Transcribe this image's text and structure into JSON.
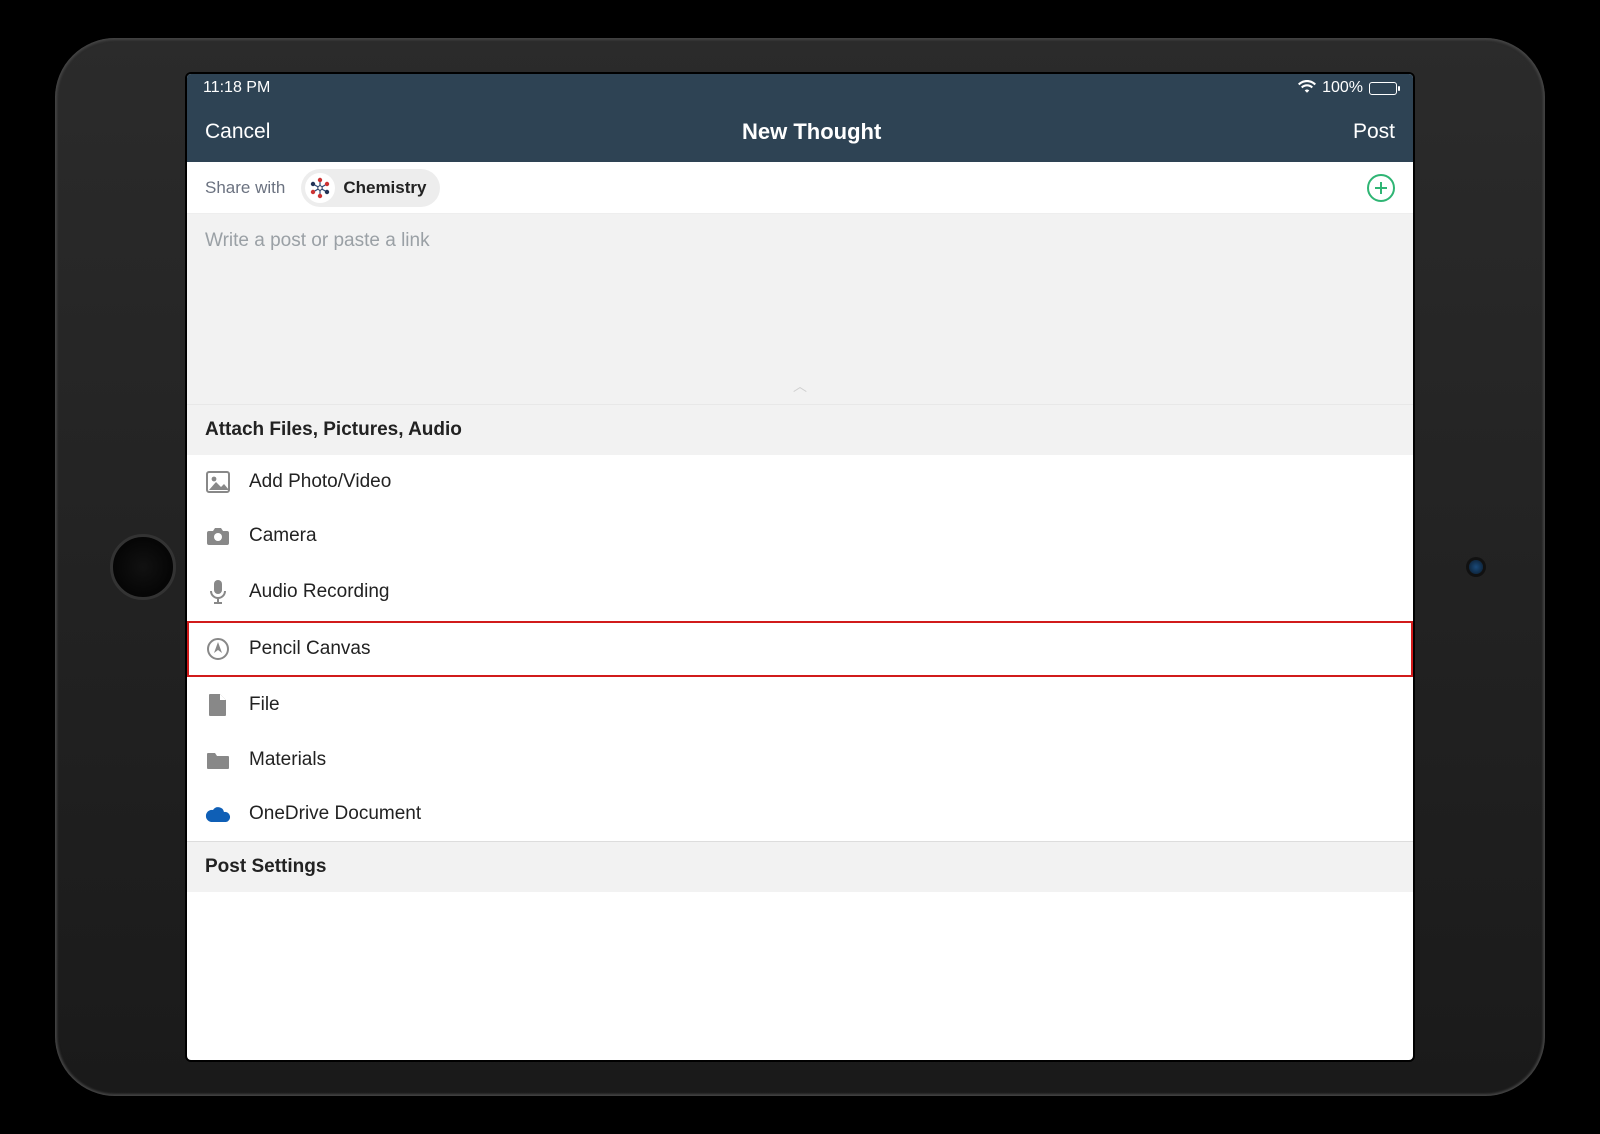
{
  "statusbar": {
    "time": "11:18 PM",
    "battery_pct": "100%"
  },
  "navbar": {
    "cancel": "Cancel",
    "title": "New Thought",
    "post": "Post"
  },
  "share": {
    "label": "Share with",
    "chip_name": "Chemistry"
  },
  "compose": {
    "placeholder": "Write a post or paste a link"
  },
  "attach_header": "Attach Files, Pictures, Audio",
  "attachments": [
    {
      "id": "add-photo-video",
      "label": "Add Photo/Video"
    },
    {
      "id": "camera",
      "label": "Camera"
    },
    {
      "id": "audio-recording",
      "label": "Audio Recording"
    },
    {
      "id": "pencil-canvas",
      "label": "Pencil Canvas",
      "highlighted": true
    },
    {
      "id": "file",
      "label": "File"
    },
    {
      "id": "materials",
      "label": "Materials"
    },
    {
      "id": "onedrive",
      "label": "OneDrive Document"
    }
  ],
  "post_settings_header": "Post Settings",
  "colors": {
    "navbar": "#2e4354",
    "accent_green": "#2fb574",
    "highlight": "#d11b1b",
    "onedrive": "#0f5fb6"
  }
}
